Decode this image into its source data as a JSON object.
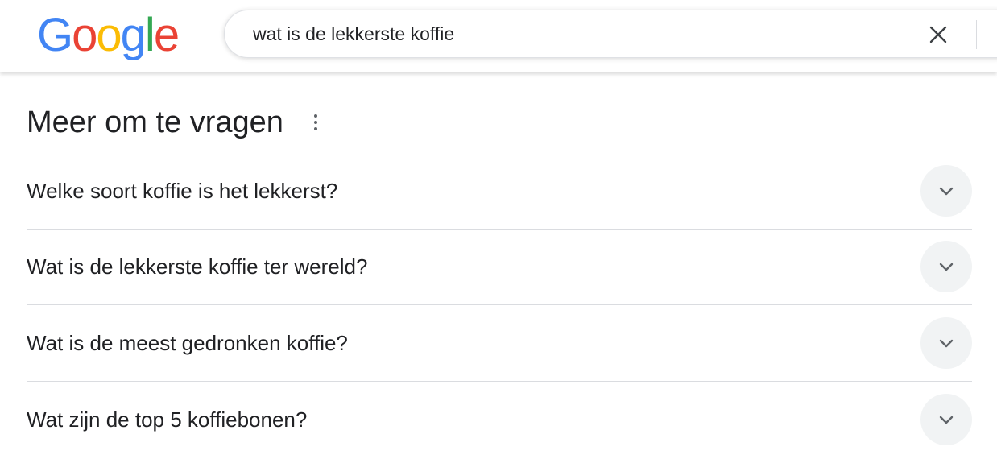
{
  "logo": {
    "letters": [
      {
        "char": "G",
        "color": "#4285f4"
      },
      {
        "char": "o",
        "color": "#ea4335"
      },
      {
        "char": "o",
        "color": "#fbbc05"
      },
      {
        "char": "g",
        "color": "#4285f4"
      },
      {
        "char": "l",
        "color": "#34a853"
      },
      {
        "char": "e",
        "color": "#ea4335"
      }
    ]
  },
  "search": {
    "value": "wat is de lekkerste koffie",
    "clear_icon": "close-icon"
  },
  "people_also_ask": {
    "title": "Meer om te vragen",
    "menu_icon": "more-vert-icon",
    "questions": [
      {
        "text": "Welke soort koffie is het lekkerst?",
        "icon": "chevron-down-icon"
      },
      {
        "text": "Wat is de lekkerste koffie ter wereld?",
        "icon": "chevron-down-icon"
      },
      {
        "text": "Wat is de meest gedronken koffie?",
        "icon": "chevron-down-icon"
      },
      {
        "text": "Wat zijn de top 5 koffiebonen?",
        "icon": "chevron-down-icon"
      }
    ]
  },
  "colors": {
    "text": "#202124",
    "icon": "#5f6368",
    "chevron_bg": "#f1f3f4",
    "divider": "#dadce0"
  }
}
